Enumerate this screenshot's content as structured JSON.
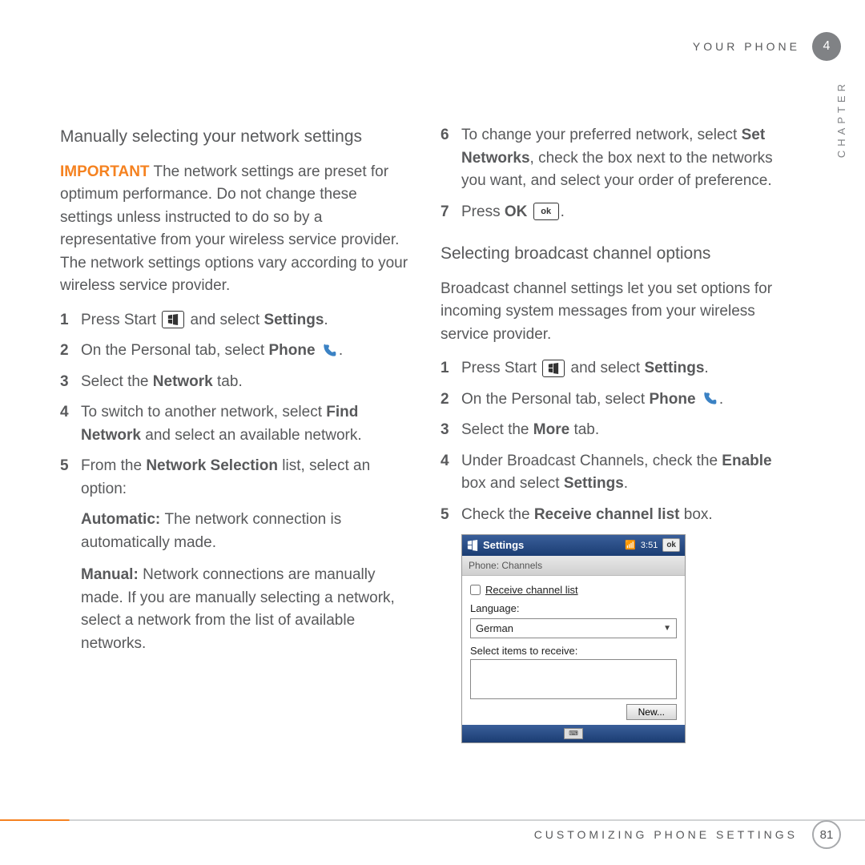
{
  "header": {
    "your_phone": "YOUR PHONE",
    "chapter_num": "4",
    "chapter_word": "CHAPTER"
  },
  "left": {
    "heading": "Manually selecting your network settings",
    "important_label": "IMPORTANT",
    "important_text": " The network settings are preset for optimum performance. Do not change these settings unless instructed to do so by a representative from your wireless service provider. The network settings options vary according to your wireless service provider.",
    "s1a": "Press Start ",
    "s1b": "and select ",
    "s1c": "Settings",
    "s1d": ".",
    "s2a": "On the Personal tab, select ",
    "s2b": "Phone ",
    "s2c": ".",
    "s3a": "Select the ",
    "s3b": "Network",
    "s3c": " tab.",
    "s4a": "To switch to another network, select ",
    "s4b": "Find Network",
    "s4c": " and select an available network.",
    "s5a": "From the ",
    "s5b": "Network Selection",
    "s5c": " list, select an option:",
    "auto_label": "Automatic: ",
    "auto_text": "The network connection is automatically made.",
    "manual_label": "Manual: ",
    "manual_text": "Network connections are manually made. If you are manually selecting a network, select a network from the list of available networks."
  },
  "right": {
    "s6a": "To change your preferred network, select ",
    "s6b": "Set Networks",
    "s6c": ", check the box next to the networks you want, and select your order of preference.",
    "s7a": "Press ",
    "s7b": "OK ",
    "s7c": ".",
    "heading2": "Selecting broadcast channel options",
    "intro2": "Broadcast channel settings let you set options for incoming system messages from your wireless service provider.",
    "rs1a": "Press Start ",
    "rs1b": " and select ",
    "rs1c": "Settings",
    "rs1d": ".",
    "rs2a": "On the Personal tab, select ",
    "rs2b": "Phone ",
    "rs2c": ".",
    "rs3a": "Select the ",
    "rs3b": "More",
    "rs3c": " tab.",
    "rs4a": "Under Broadcast Channels, check the ",
    "rs4b": "Enable",
    "rs4c": " box and select ",
    "rs4d": "Settings",
    "rs4e": ".",
    "rs5a": "Check the ",
    "rs5b": "Receive channel list",
    "rs5c": " box."
  },
  "shot": {
    "title": "Settings",
    "time": "3:51",
    "ok": "ok",
    "sub": "Phone: Channels",
    "receive": "Receive channel list",
    "lang_label": "Language:",
    "lang_value": "German",
    "select_items": "Select items to receive:",
    "new_btn": "New..."
  },
  "footer": {
    "text": "CUSTOMIZING PHONE SETTINGS",
    "page": "81"
  },
  "nums": {
    "n1": "1",
    "n2": "2",
    "n3": "3",
    "n4": "4",
    "n5": "5",
    "n6": "6",
    "n7": "7"
  },
  "icons": {
    "ok_small": "ok"
  }
}
